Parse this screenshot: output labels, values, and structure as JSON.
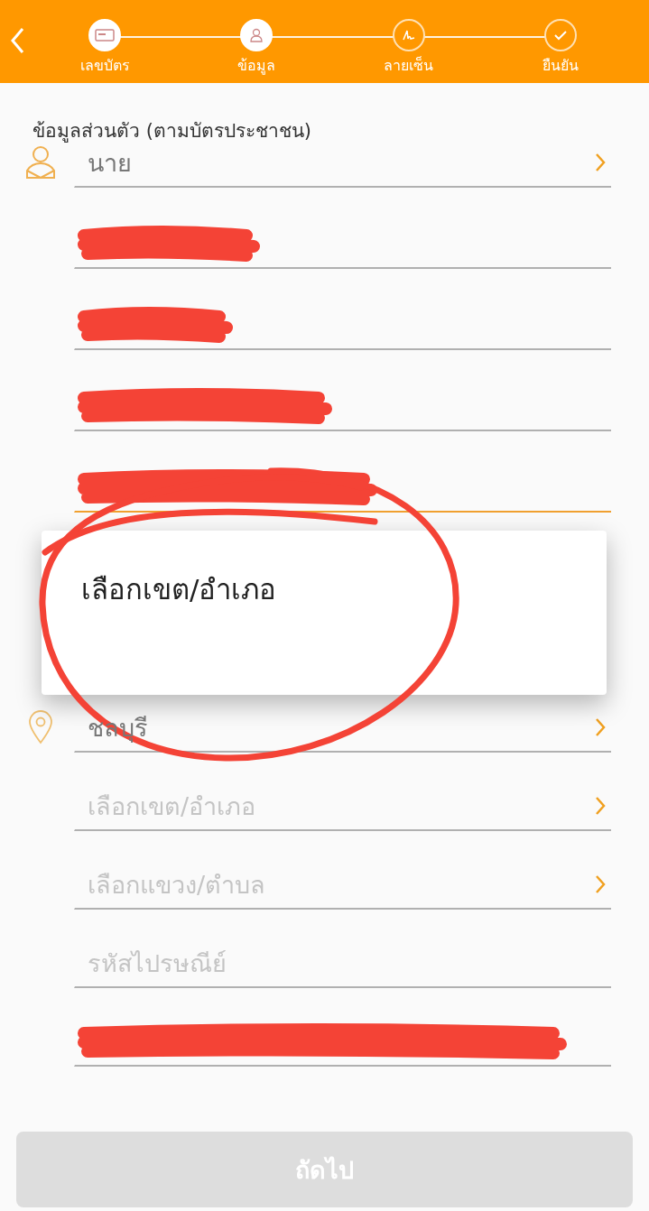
{
  "header": {
    "steps": [
      {
        "label": "เลขบัตร",
        "kind": "card",
        "completed": true
      },
      {
        "label": "ข้อมูล",
        "kind": "person",
        "completed": true
      },
      {
        "label": "ลายเซ็น",
        "kind": "signature",
        "completed": false
      },
      {
        "label": "ยืนยัน",
        "kind": "check",
        "completed": false
      }
    ]
  },
  "section_title": "ข้อมูลส่วนตัว (ตามบัตรประชาชน)",
  "fields": [
    {
      "kind": "title-select",
      "value": "นาย",
      "redacted": false,
      "focused": false
    },
    {
      "kind": "text",
      "redacted": true,
      "focused": false
    },
    {
      "kind": "text",
      "redacted": true,
      "focused": false
    },
    {
      "kind": "text",
      "redacted": true,
      "focused": false
    },
    {
      "kind": "text",
      "redacted": true,
      "focused": true
    },
    {
      "kind": "gap"
    },
    {
      "kind": "province-select",
      "value": "ชลบุรี",
      "redacted": false,
      "focused": false
    },
    {
      "kind": "select",
      "placeholder": "เลือกเขต/อำเภอ",
      "redacted": false,
      "focused": false
    },
    {
      "kind": "select",
      "placeholder": "เลือกแขวง/ตำบล",
      "redacted": false,
      "focused": false
    },
    {
      "kind": "text",
      "placeholder": "รหัสไปรษณีย์",
      "redacted": false,
      "focused": false
    },
    {
      "kind": "text",
      "redacted": true,
      "focused": false
    }
  ],
  "dropdown": {
    "options": [
      "เลือกเขต/อำเภอ"
    ]
  },
  "markup": {
    "kind": "circle"
  },
  "next_button": {
    "label": "ถัดไป",
    "disabled": true
  }
}
